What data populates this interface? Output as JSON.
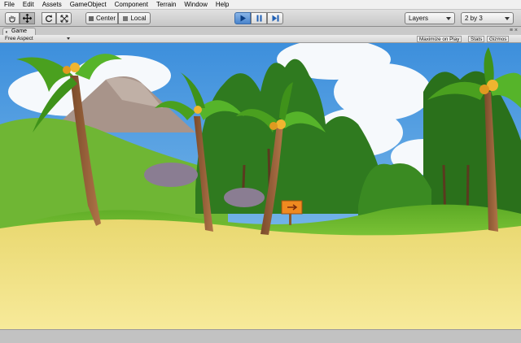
{
  "menu": [
    "File",
    "Edit",
    "Assets",
    "GameObject",
    "Component",
    "Terrain",
    "Window",
    "Help"
  ],
  "toolbar": {
    "tools": [
      {
        "name": "hand-tool",
        "icon": "hand-icon"
      },
      {
        "name": "move-tool",
        "icon": "move-arrows-icon"
      },
      {
        "name": "rotate-tool",
        "icon": "rotate-icon"
      },
      {
        "name": "scale-tool",
        "icon": "scale-icon"
      }
    ],
    "pivot_label": "Center",
    "space_label": "Local",
    "playback": [
      "play-icon",
      "pause-icon",
      "step-icon"
    ],
    "layers_label": "Layers",
    "layout_label": "2 by 3",
    "accent_color": "#4a84cc"
  },
  "tab": {
    "label": "Game",
    "icon": "pacman-game-icon",
    "window_controls": "≡ ×"
  },
  "game_bar": {
    "aspect_label": "Free Aspect",
    "maximize_label": "Maximize on Play",
    "stats_label": "Stats",
    "gizmos_label": "Gizmos"
  },
  "scene": {
    "description_icon": "tropical-island-scene",
    "sign_icon": "arrow-sign-icon",
    "sky_color": "#5aa2e0",
    "sand_color": "#f0e08a",
    "grass_color": "#7ec832"
  }
}
